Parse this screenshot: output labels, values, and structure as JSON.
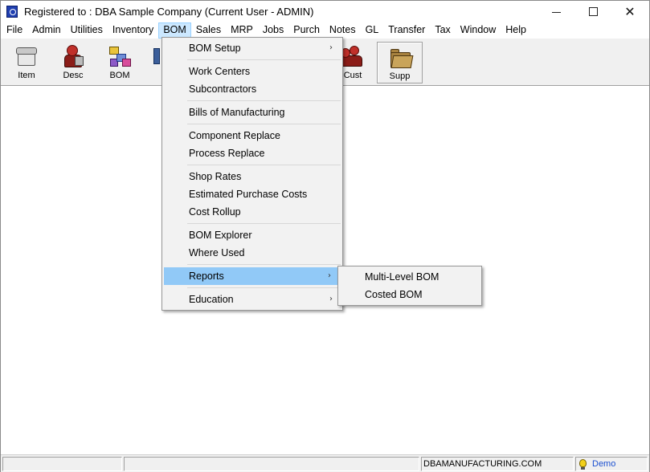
{
  "window": {
    "title": "Registered to : DBA Sample Company (Current User - ADMIN)",
    "minimize": "—",
    "maximize": "☐",
    "close": "✕"
  },
  "menubar": {
    "items": [
      "File",
      "Admin",
      "Utilities",
      "Inventory",
      "BOM",
      "Sales",
      "MRP",
      "Jobs",
      "Purch",
      "Notes",
      "GL",
      "Transfer",
      "Tax",
      "Window",
      "Help"
    ],
    "active": "BOM"
  },
  "toolbar": {
    "buttons": [
      {
        "label": "Item",
        "icon": "item-box-icon"
      },
      {
        "label": "Desc",
        "icon": "person-tag-icon"
      },
      {
        "label": "BOM",
        "icon": "blocks-icon"
      },
      {
        "label": "Cust",
        "icon": "people-icon"
      },
      {
        "label": "Supp",
        "icon": "folder-icon"
      }
    ]
  },
  "bom_menu": {
    "items": {
      "bom_setup": "BOM Setup",
      "work_centers": "Work Centers",
      "subcontractors": "Subcontractors",
      "bills_of_manufacturing": "Bills of Manufacturing",
      "component_replace": "Component Replace",
      "process_replace": "Process Replace",
      "shop_rates": "Shop Rates",
      "estimated_purchase_costs": "Estimated Purchase Costs",
      "cost_rollup": "Cost Rollup",
      "bom_explorer": "BOM Explorer",
      "where_used": "Where Used",
      "reports": "Reports",
      "education": "Education"
    },
    "submenu_arrow": "›",
    "highlighted": "Reports"
  },
  "reports_submenu": {
    "items": [
      "Multi-Level BOM",
      "Costed BOM"
    ]
  },
  "statusbar": {
    "pane1": "",
    "pane2": "",
    "website": "DBAMANUFACTURING.COM",
    "mode": "Demo"
  }
}
